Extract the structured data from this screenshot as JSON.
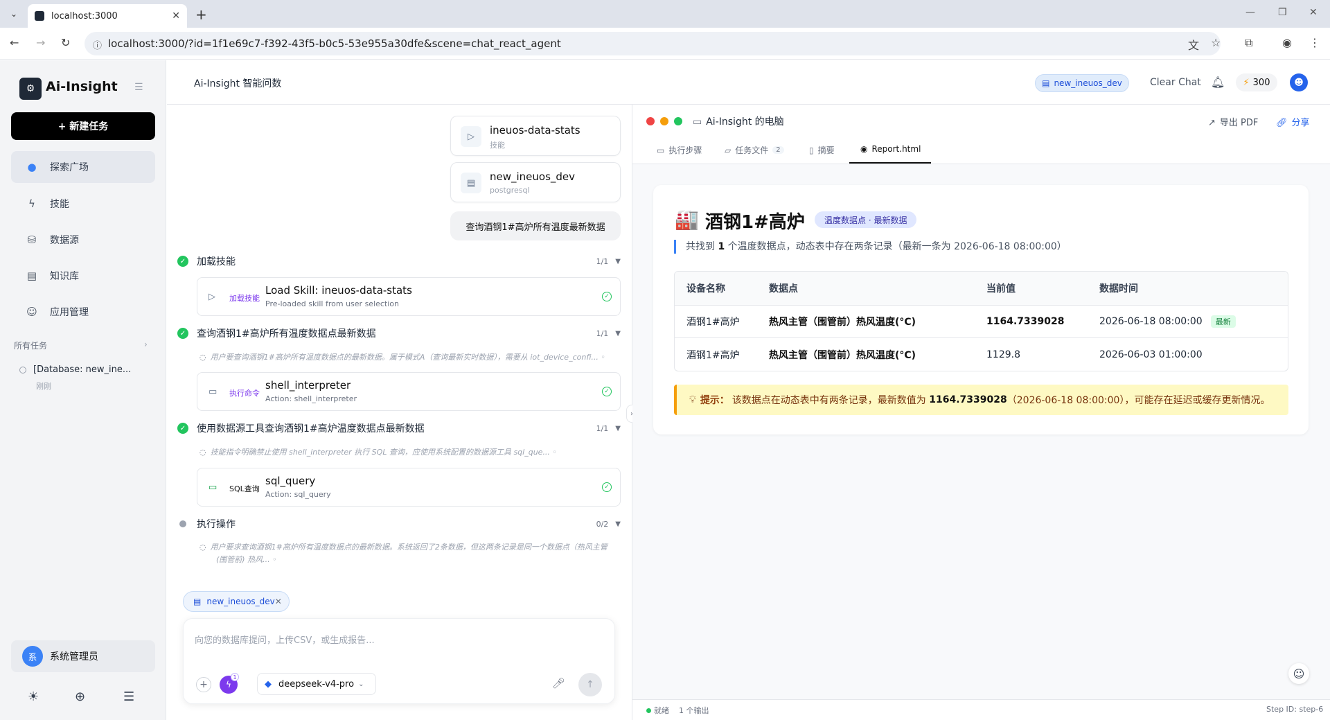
{
  "browser": {
    "tab_title": "localhost:3000",
    "url": "localhost:3000/?id=1f1e69c7-f392-43f5-b0c5-53e955a30dfe&scene=chat_react_agent"
  },
  "sidebar": {
    "app_name": "Ai-Insight",
    "new_task_label": "+ 新建任务",
    "nav": [
      {
        "label": "探索广场",
        "icon": "globe-icon"
      },
      {
        "label": "技能",
        "icon": "bolt-icon"
      },
      {
        "label": "数据源",
        "icon": "database-icon"
      },
      {
        "label": "知识库",
        "icon": "book-icon"
      },
      {
        "label": "应用管理",
        "icon": "robot-icon"
      }
    ],
    "all_tasks_label": "所有任务",
    "task": {
      "title": "[Database: new_ine...",
      "time": "刚刚"
    },
    "user": {
      "initial": "系",
      "name": "系统管理员"
    }
  },
  "header": {
    "title": "Ai-Insight 智能问数",
    "db_chip": "new_ineuos_dev",
    "clear_chat": "Clear Chat",
    "credits": "300"
  },
  "chat": {
    "context_cards": [
      {
        "title": "ineuos-data-stats",
        "sub": "技能"
      },
      {
        "title": "new_ineuos_dev",
        "sub": "postgresql"
      }
    ],
    "user_message": "查询酒钢1#高炉所有温度最新数据",
    "steps": [
      {
        "title": "加载技能",
        "count": "1/1",
        "action": {
          "tag": "加载技能",
          "name": "Load Skill: ineuos-data-stats",
          "sub": "Pre-loaded skill from user selection"
        }
      },
      {
        "title": "查询酒钢1#高炉所有温度数据点最新数据",
        "count": "1/1",
        "thought": "用户要查询酒钢1#高炉所有温度数据点的最新数据。属于模式A（查询最新实时数据），需要从 iot_device_confi... ◦",
        "action": {
          "tag": "执行命令",
          "name": "shell_interpreter",
          "sub": "Action: shell_interpreter"
        }
      },
      {
        "title": "使用数据源工具查询酒钢1#高炉温度数据点最新数据",
        "count": "1/1",
        "thought": "技能指令明确禁止使用 shell_interpreter 执行 SQL 查询，应使用系统配置的数据源工具 sql_que... ◦",
        "action": {
          "tag": "SQL查询",
          "name": "sql_query",
          "sub": "Action: sql_query"
        }
      },
      {
        "title": "执行操作",
        "count": "0/2",
        "thought_line1": "用户要求查询酒钢1#高炉所有温度数据点的最新数据。系统返回了2条数据，但这两条记录是同一个数据点（热风主管",
        "thought_line2": "(围管前) 热风... ◦"
      }
    ],
    "composer": {
      "context_chip": "new_ineuos_dev",
      "placeholder": "向您的数据库提问，上传CSV，或生成报告...",
      "skill_badge": "1",
      "model": "deepseek-v4-pro"
    }
  },
  "panel": {
    "title": "Ai-Insight 的电脑",
    "export": "导出 PDF",
    "share": "分享",
    "tabs": [
      {
        "label": "执行步骤"
      },
      {
        "label": "任务文件",
        "count": "2"
      },
      {
        "label": "摘要"
      },
      {
        "label": "Report.html"
      }
    ],
    "report": {
      "title": "酒钢1#高炉",
      "badge": "温度数据点 · 最新数据",
      "summary_pre": "共找到",
      "summary_num": "1",
      "summary_post": "个温度数据点，动态表中存在两条记录（最新一条为 2026-06-18 08:00:00）",
      "table": {
        "headers": [
          "设备名称",
          "数据点",
          "当前值",
          "数据时间"
        ],
        "rows": [
          {
            "device": "酒钢1#高炉",
            "point": "热风主管（围管前）热风温度(°C)",
            "value": "1164.7339028",
            "time": "2026-06-18 08:00:00",
            "badge": "最新"
          },
          {
            "device": "酒钢1#高炉",
            "point": "热风主管（围管前）热风温度(°C)",
            "value": "1129.8",
            "time": "2026-06-03 01:00:00"
          }
        ]
      },
      "tip_label": "提示：",
      "tip_pre": "该数据点在动态表中有两条记录，最新数值为",
      "tip_value": "1164.7339028",
      "tip_post": "（2026-06-18 08:00:00），可能存在延迟或缓存更新情况。"
    },
    "status": {
      "ready": "就绪",
      "outputs": "1 个输出",
      "step_id": "Step ID: step-6"
    }
  }
}
